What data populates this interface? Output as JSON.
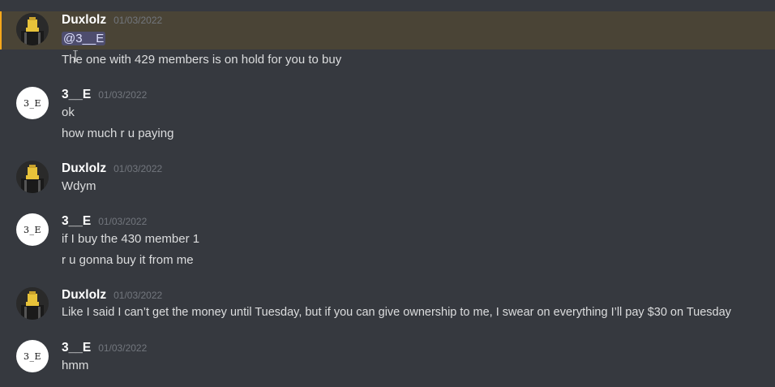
{
  "messages": [
    {
      "author": "Duxlolz",
      "timestamp": "01/03/2022",
      "avatar": "duxlolz-avatar",
      "highlighted": true,
      "lines": [
        {
          "mention": "@3__E"
        },
        {
          "text": "The one with 429 members is on hold for you to buy"
        }
      ]
    },
    {
      "author": "3__E",
      "timestamp": "01/03/2022",
      "avatar_text": "3_E",
      "lines": [
        {
          "text": "ok"
        },
        {
          "text": "how much r u paying"
        }
      ]
    },
    {
      "author": "Duxlolz",
      "timestamp": "01/03/2022",
      "lines": [
        {
          "text": "Wdym"
        }
      ]
    },
    {
      "author": "3__E",
      "timestamp": "01/03/2022",
      "avatar_text": "3_E",
      "lines": [
        {
          "text": "if I buy the 430 member 1"
        },
        {
          "text": "r u gonna buy it from me"
        }
      ]
    },
    {
      "author": "Duxlolz",
      "timestamp": "01/03/2022",
      "lines": [
        {
          "text": "Like I said I can’t get the money until Tuesday, but if you can give ownership to me, I swear on everything I’ll pay $30 on Tuesday"
        }
      ]
    },
    {
      "author": "3__E",
      "timestamp": "01/03/2022",
      "avatar_text": "3_E",
      "lines": [
        {
          "text": "hmm"
        }
      ]
    }
  ],
  "colors": {
    "background": "#36393f",
    "mention_highlight": "#4a4436",
    "mention_border": "#faa81a",
    "username": "#ffffff",
    "text": "#dcddde",
    "timestamp": "#72767d"
  }
}
